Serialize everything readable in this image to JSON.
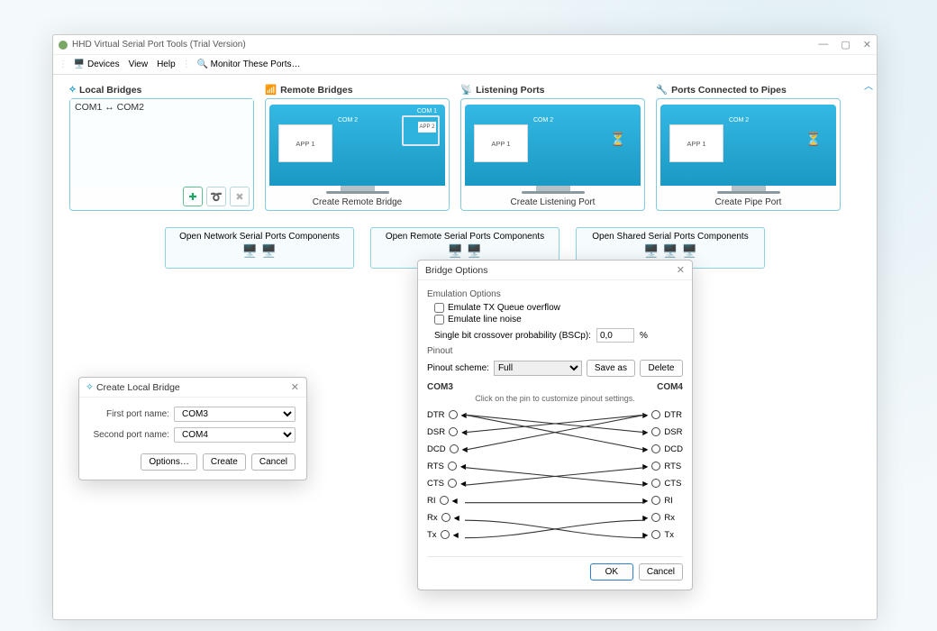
{
  "window": {
    "title": "HHD Virtual Serial Port Tools (Trial Version)",
    "min": "—",
    "max": "▢",
    "close": "✕"
  },
  "toolbar": {
    "devices": "Devices",
    "view": "View",
    "help": "Help",
    "monitor": "Monitor These Ports…"
  },
  "sections": {
    "local": {
      "title": "Local Bridges",
      "entry": "COM1 ↔ COM2"
    },
    "remote": {
      "title": "Remote Bridges",
      "foot": "Create Remote Bridge",
      "app": "APP 1",
      "com2": "COM 2",
      "com1": "COM 1",
      "app2": "APP 2"
    },
    "listen": {
      "title": "Listening Ports",
      "foot": "Create Listening Port",
      "app": "APP 1",
      "com2": "COM 2"
    },
    "pipes": {
      "title": "Ports Connected to Pipes",
      "foot": "Create Pipe Port",
      "app": "APP 1",
      "com2": "COM 2"
    }
  },
  "components": {
    "c1": "Open Network Serial Ports Components",
    "c2": "Open Remote Serial Ports Components",
    "c3": "Open Shared Serial Ports Components"
  },
  "dlg1": {
    "title": "Create Local Bridge",
    "first_label": "First port name:",
    "first_value": "COM3",
    "second_label": "Second port name:",
    "second_value": "COM4",
    "options": "Options…",
    "create": "Create",
    "cancel": "Cancel"
  },
  "dlg2": {
    "title": "Bridge Options",
    "emu_group": "Emulation Options",
    "chk1": "Emulate TX Queue overflow",
    "chk2": "Emulate line noise",
    "prob_label": "Single bit crossover probability (BSCp):",
    "prob_value": "0,0",
    "prob_unit": "%",
    "pinout_group": "Pinout",
    "scheme_label": "Pinout scheme:",
    "scheme_value": "Full",
    "saveas": "Save as",
    "delete": "Delete",
    "left_port": "COM3",
    "right_port": "COM4",
    "hint": "Click on the pin to customize pinout settings.",
    "pins": [
      "DTR",
      "DSR",
      "DCD",
      "RTS",
      "CTS",
      "RI",
      "Rx",
      "Tx"
    ],
    "ok": "OK",
    "cancel": "Cancel"
  }
}
